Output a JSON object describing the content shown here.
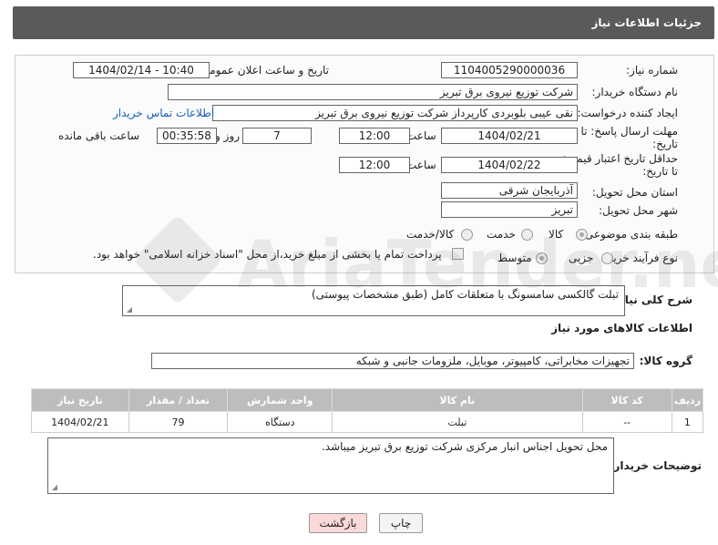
{
  "header": {
    "title": "جزئیات اطلاعات نیاز"
  },
  "form": {
    "need_number_label": "شماره نیاز:",
    "need_number": "1104005290000036",
    "announce_label": "تاریخ و ساعت اعلان عمومی:",
    "announce_value": "1404/02/14 - 10:40",
    "buyer_org_label": "نام دستگاه خریدار:",
    "buyer_org": "شرکت توزیع نیروی برق تبریز",
    "creator_label": "ایجاد کننده درخواست:",
    "creator": "نقی عیبی بلوبردی کارپرداز شرکت توزیع نیروی برق تبریز",
    "contact_link": "اطلاعات تماس خریدار",
    "deadline_label_1": "مهلت ارسال پاسخ: تا",
    "deadline_label_2": "تاریخ:",
    "deadline_date": "1404/02/21",
    "time_label": "ساعت",
    "deadline_time": "12:00",
    "days_value": "7",
    "days_label": "روز و",
    "remaining_value": "00:35:58",
    "remaining_label": "ساعت باقی مانده",
    "validity_label_1": "حداقل تاریخ اعتبار قیمت:",
    "validity_label_2": "تا تاریخ:",
    "validity_date": "1404/02/22",
    "validity_time": "12:00",
    "province_label": "استان محل تحویل:",
    "province": "آذربایجان شرقی",
    "city_label": "شهر محل تحویل:",
    "city": "تبریز",
    "category_label": "طبقه بندی موضوعی:",
    "category_options": [
      "کالا",
      "خدمت",
      "کالا/خدمت"
    ],
    "process_label": "نوع فرآیند خرید :",
    "process_options": [
      "جزیی",
      "متوسط"
    ],
    "payment_note": "پرداخت تمام یا بخشی از مبلغ خرید،از محل \"اسناد خزانه اسلامی\" خواهد بود."
  },
  "summary": {
    "label": "شرح کلی نیاز:",
    "value": "تبلت گالکسی سامسونگ با متعلقات کامل (طبق مشخصات پیوستی)"
  },
  "goods_section": {
    "title": "اطلاعات کالاهای مورد نیاز"
  },
  "goods_group": {
    "label": "گروه کالا:",
    "value": "تجهیزات مخابراتی، کامپیوتر، موبایل، ملزومات جانبی و شبکه"
  },
  "table": {
    "headers": [
      "ردیف",
      "کد کالا",
      "نام کالا",
      "واحد شمارش",
      "تعداد / مقدار",
      "تاریخ نیاز"
    ],
    "rows": [
      [
        "1",
        "--",
        "تبلت",
        "دستگاه",
        "79",
        "1404/02/21"
      ]
    ]
  },
  "buyer_notes": {
    "label": "توضیحات خریدار:",
    "value": "محل تحویل اجناس انبار مرکزی شرکت توزیع برق تبریز میباشد."
  },
  "buttons": {
    "print": "چاپ",
    "back": "بازگشت"
  },
  "watermark": {
    "text": "AriaTender.net"
  },
  "colors": {
    "header_bg": "#5a5a5a",
    "table_header_bg": "#bdbdbd",
    "link": "#1a5fb4",
    "back_button_bg": "#f9d9d9"
  }
}
